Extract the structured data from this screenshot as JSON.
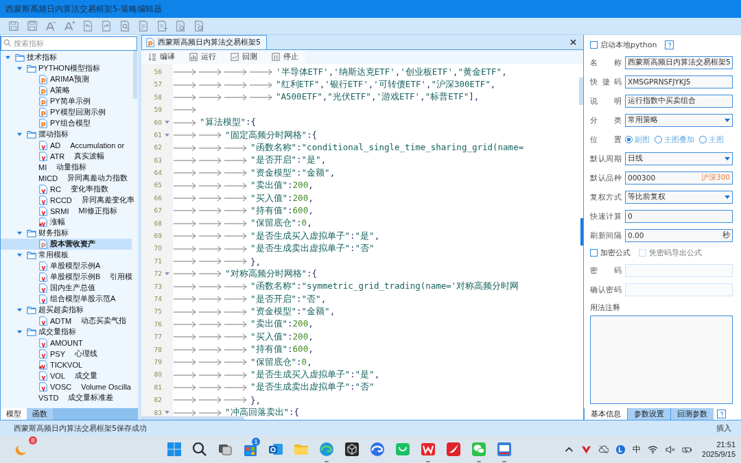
{
  "window": {
    "title": "西蒙斯高频日内算法交易框架5-策略编辑器"
  },
  "sidebar": {
    "search": {
      "placeholder": "搜索指标"
    },
    "tree": [
      {
        "label": "技术指标",
        "kind": "folder",
        "expanded": true,
        "selected": false,
        "children": [
          {
            "label": "PYTHON模型指标",
            "kind": "folder",
            "expanded": true,
            "selected": false,
            "children": [
              {
                "label": "ARIMA预测",
                "kind": "python",
                "selected": false
              },
              {
                "label": "A策略",
                "kind": "python",
                "selected": false
              },
              {
                "label": "PY简单示例",
                "kind": "python",
                "selected": false
              },
              {
                "label": "PY模型回测示例",
                "kind": "python",
                "selected": false
              },
              {
                "label": "PY组合模型",
                "kind": "python",
                "selected": false
              }
            ]
          },
          {
            "label": "摆动指标",
            "kind": "folder",
            "expanded": true,
            "selected": false,
            "children": [
              {
                "label": "AD",
                "description": "Accumulation or",
                "kind": "formula",
                "selected": false
              },
              {
                "label": "ATR",
                "description": "真实波幅",
                "kind": "formula",
                "selected": false
              },
              {
                "label": "MI",
                "description": "动量指标",
                "kind": "plain",
                "selected": false
              },
              {
                "label": "MICD",
                "description": "异同离差动力指数",
                "kind": "plain",
                "selected": false
              },
              {
                "label": "RC",
                "description": "变化率指数",
                "kind": "formula",
                "selected": false
              },
              {
                "label": "RCCD",
                "description": "异同离差变化率",
                "kind": "formula",
                "selected": false
              },
              {
                "label": "SRMI",
                "description": "MI修正指标",
                "kind": "formula",
                "selected": false
              },
              {
                "label": "涨幅",
                "kind": "locked",
                "selected": false
              }
            ]
          },
          {
            "label": "财务指标",
            "kind": "folder",
            "expanded": true,
            "selected": false,
            "children": [
              {
                "label": "股本营收资产",
                "kind": "python-grey",
                "selected": true
              }
            ]
          },
          {
            "label": "常用模板",
            "kind": "folder",
            "expanded": true,
            "selected": false,
            "children": [
              {
                "label": "单股模型示例A",
                "kind": "formula",
                "selected": false
              },
              {
                "label": "单股模型示例B",
                "description": "引用模",
                "kind": "formula",
                "selected": false
              },
              {
                "label": "国内生产总值",
                "kind": "formula",
                "selected": false
              },
              {
                "label": "组合模型单股示范A",
                "kind": "formula",
                "selected": false
              }
            ]
          },
          {
            "label": "超买超卖指标",
            "kind": "folder",
            "expanded": true,
            "selected": false,
            "children": [
              {
                "label": "ADTM",
                "description": "动态买卖气指",
                "kind": "formula",
                "selected": false
              }
            ]
          },
          {
            "label": "成交量指标",
            "kind": "folder",
            "expanded": true,
            "selected": false,
            "children": [
              {
                "label": "AMOUNT",
                "kind": "formula",
                "selected": false
              },
              {
                "label": "PSY",
                "description": "心理线",
                "kind": "formula",
                "selected": false
              },
              {
                "label": "TICKVOL",
                "kind": "locked",
                "selected": false
              },
              {
                "label": "VOL",
                "description": "成交量",
                "kind": "formula",
                "selected": false
              },
              {
                "label": "VOSC",
                "description": "Volume Oscilla",
                "kind": "formula",
                "selected": false
              },
              {
                "label": "VSTD",
                "description": "成交量标准差",
                "kind": "plain",
                "selected": false
              }
            ]
          }
        ]
      }
    ],
    "tabs": [
      {
        "label": "模型",
        "selected": true
      },
      {
        "label": "函数",
        "selected": false
      }
    ]
  },
  "editor": {
    "tab": {
      "title": "西蒙斯高频日内算法交易框架5"
    },
    "actions": [
      {
        "kind": "compile",
        "label": "编译"
      },
      {
        "kind": "run",
        "label": "运行"
      },
      {
        "kind": "backtest",
        "label": "回测"
      },
      {
        "kind": "stop",
        "label": "停止"
      }
    ],
    "lines": [
      {
        "number": "56",
        "text": "\t\t\t\t'半导体ETF','纳斯达克ETF','创业板ETF',\"黄金ETF\",",
        "foldable": false
      },
      {
        "number": "57",
        "text": "\t\t\t\t\"红利ETF\",'银行ETF','可转债ETF',\"沪深300ETF\",",
        "foldable": false
      },
      {
        "number": "58",
        "text": "\t\t\t\t\"A500ETF\",\"光伏ETF\",'游戏ETF',\"标普ETF\"],",
        "foldable": false
      },
      {
        "number": "59",
        "kind": "blank",
        "foldable": false
      },
      {
        "number": "60",
        "text": "\t\"算法模型\":{",
        "foldable": true
      },
      {
        "number": "61",
        "text": "\t\t\"固定高频分时网格\":{",
        "foldable": true
      },
      {
        "number": "62",
        "text": "\t\t\t\"函数名称\":\"conditional_single_time_sharing_grid(name=",
        "foldable": false
      },
      {
        "number": "63",
        "text": "\t\t\t\"是否开启\":\"是\",",
        "foldable": false
      },
      {
        "number": "64",
        "text": "\t\t\t\"资金模型\":\"金额\",",
        "foldable": false
      },
      {
        "number": "65",
        "text": "\t\t\t\"卖出值\":200,",
        "foldable": false
      },
      {
        "number": "66",
        "text": "\t\t\t\"买入值\":200,",
        "foldable": false
      },
      {
        "number": "67",
        "text": "\t\t\t\"持有值\":600,",
        "foldable": false
      },
      {
        "number": "68",
        "text": "\t\t\t\"保留底仓\":0,",
        "foldable": false
      },
      {
        "number": "69",
        "text": "\t\t\t\"是否生成买入虚拟单子\":\"是\",",
        "foldable": false
      },
      {
        "number": "70",
        "text": "\t\t\t\"是否生成卖出虚拟单子\":\"否\"",
        "foldable": false
      },
      {
        "number": "71",
        "text": "\t\t\t},",
        "foldable": false
      },
      {
        "number": "72",
        "text": "\t\t\"对称高频分时网格\":{",
        "foldable": true
      },
      {
        "number": "73",
        "text": "\t\t\t\"函数名称\":\"symmetric_grid_trading(name='对称高频分时网",
        "foldable": false
      },
      {
        "number": "74",
        "text": "\t\t\t\"是否开启\":\"否\",",
        "foldable": false
      },
      {
        "number": "75",
        "text": "\t\t\t\"资金模型\":\"金额\",",
        "foldable": false
      },
      {
        "number": "76",
        "text": "\t\t\t\"卖出值\":200,",
        "foldable": false
      },
      {
        "number": "77",
        "text": "\t\t\t\"买入值\":200,",
        "foldable": false
      },
      {
        "number": "78",
        "text": "\t\t\t\"持有值\":600,",
        "foldable": false
      },
      {
        "number": "79",
        "text": "\t\t\t\"保留底仓\":0,",
        "foldable": false
      },
      {
        "number": "80",
        "text": "\t\t\t\"是否生成买入虚拟单子\":\"是\",",
        "foldable": false
      },
      {
        "number": "81",
        "text": "\t\t\t\"是否生成卖出虚拟单子\":\"否\"",
        "foldable": false
      },
      {
        "number": "82",
        "text": "\t\t\t},",
        "foldable": false
      },
      {
        "number": "83",
        "text": "\t\t\"冲高回落卖出\":{",
        "foldable": true
      }
    ]
  },
  "properties": {
    "local_python": {
      "label": "启动本地python",
      "checked": false
    },
    "fields": [
      {
        "kind": "text",
        "label": "名称",
        "value": "西蒙斯高频日内算法交易框架5"
      },
      {
        "kind": "text",
        "label": "快捷码",
        "value": "XMSGPRNSFJYKJ5"
      },
      {
        "kind": "text",
        "label": "说明",
        "value": "运行指数中买卖组合"
      },
      {
        "kind": "select",
        "label": "分类",
        "value": "常用策略"
      },
      {
        "kind": "radio",
        "label": "位置",
        "options": [
          {
            "label": "副图",
            "selected": true
          },
          {
            "label": "主图叠加",
            "selected": false
          },
          {
            "label": "主图",
            "selected": false
          }
        ]
      },
      {
        "kind": "select",
        "label": "默认周期",
        "value": "日线"
      },
      {
        "kind": "text",
        "label": "默认品种",
        "value": "000300",
        "suffix": "沪深300"
      },
      {
        "kind": "select",
        "label": "复权方式",
        "value": "等比前复权"
      },
      {
        "kind": "text",
        "label": "快速计算",
        "value": "0"
      },
      {
        "kind": "text",
        "label": "刷新间隔",
        "value": "0.00",
        "unit": "秒"
      },
      {
        "kind": "checks",
        "options": [
          {
            "label": "加密公式",
            "checked": false,
            "disabled": false
          },
          {
            "label": "凭密码导出公式",
            "checked": false,
            "disabled": true
          }
        ]
      },
      {
        "kind": "password",
        "label": "密码",
        "disabled": true
      },
      {
        "kind": "password",
        "label": "确认密码",
        "disabled": true
      },
      {
        "kind": "textarea",
        "label": "用法注释"
      }
    ],
    "tabs": [
      {
        "label": "基本信息",
        "selected": true
      },
      {
        "label": "参数设置",
        "selected": false
      },
      {
        "label": "回测参数",
        "selected": false
      }
    ]
  },
  "status_bar": {
    "message": "西蒙斯高频日内算法交易框架5保存成功",
    "mode": "插入"
  },
  "taskbar": {
    "weather_badge": "8",
    "apps": [
      {
        "kind": "windows",
        "running": false
      },
      {
        "kind": "search",
        "running": false
      },
      {
        "kind": "taskview",
        "running": false
      },
      {
        "kind": "store",
        "running": false,
        "badge": "1"
      },
      {
        "kind": "mail",
        "running": false
      },
      {
        "kind": "folder",
        "running": false
      },
      {
        "kind": "browser",
        "running": true
      },
      {
        "kind": "cube",
        "running": false
      },
      {
        "kind": "browser-ai",
        "running": false
      },
      {
        "kind": "bag",
        "running": false
      },
      {
        "kind": "zigzag",
        "running": true
      },
      {
        "kind": "swoosh",
        "running": false
      },
      {
        "kind": "chat",
        "running": true
      },
      {
        "kind": "terminal",
        "running": true
      }
    ],
    "input_method": "中",
    "time": "21:51",
    "date": "2025/9/15"
  }
}
